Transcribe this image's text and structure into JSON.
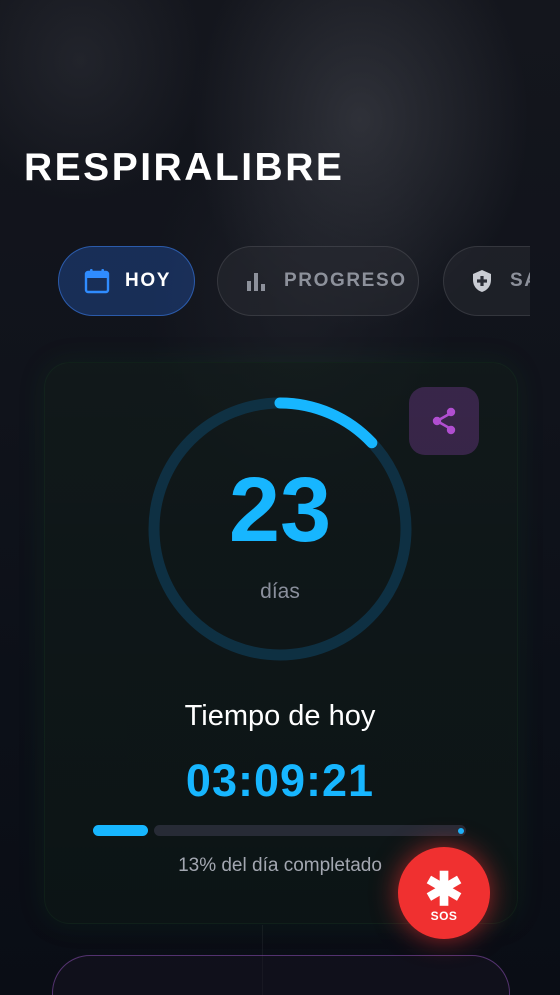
{
  "app": {
    "title": "RESPIRALIBRE"
  },
  "tabs": [
    {
      "label": "HOY",
      "icon": "calendar-icon",
      "active": true
    },
    {
      "label": "PROGRESO",
      "icon": "bar-chart-icon",
      "active": false
    },
    {
      "label": "SA",
      "icon": "shield-plus-icon",
      "active": false
    }
  ],
  "counter": {
    "days": "23",
    "days_label": "días",
    "ring_progress": 0.13
  },
  "today": {
    "label": "Tiempo de hoy",
    "timer": "03:09:21",
    "progress_percent": 13,
    "progress_text": "13% del día completado"
  },
  "share": {
    "icon": "share-icon"
  },
  "sos": {
    "icon": "asterisk-icon",
    "label": "SOS"
  },
  "colors": {
    "accent": "#17b6ff",
    "sos": "#f03030",
    "share_bg": "#5a2d72",
    "active_tab": "#224ea0"
  }
}
